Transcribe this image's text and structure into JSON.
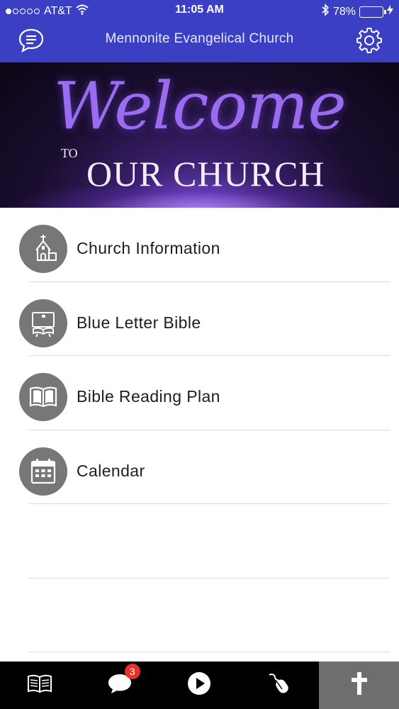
{
  "status_bar": {
    "carrier": "AT&T",
    "time": "11:05 AM",
    "battery": "78%",
    "battery_level": 0.78,
    "signal_bars_filled": 1,
    "icons": [
      "signal-dots-icon",
      "wifi-icon",
      "bluetooth-icon",
      "battery-icon",
      "charging-icon"
    ]
  },
  "header": {
    "title": "Mennonite Evangelical Church",
    "left_icon": "chat-bubble-icon",
    "right_icon": "gear-icon"
  },
  "banner": {
    "line1": "Welcome",
    "line2_small": "TO",
    "line2": "OUR CHURCH"
  },
  "menu": {
    "items": [
      {
        "label": "Church Information",
        "icon": "church-icon"
      },
      {
        "label": "Blue Letter Bible",
        "icon": "bible-stand-icon"
      },
      {
        "label": "Bible Reading Plan",
        "icon": "open-book-icon"
      },
      {
        "label": "Calendar",
        "icon": "calendar-icon"
      }
    ]
  },
  "tabbar": {
    "tabs": [
      {
        "icon": "book-icon"
      },
      {
        "icon": "messages-icon",
        "badge": "3"
      },
      {
        "icon": "play-icon"
      },
      {
        "icon": "mouse-icon"
      },
      {
        "icon": "cross-icon",
        "active": true
      }
    ]
  },
  "colors": {
    "header_bg": "#3b3fc4",
    "icon_circle": "#777777",
    "battery_fill": "#4cd964",
    "badge": "#e4322b",
    "active_tab": "#6e6e6e"
  }
}
